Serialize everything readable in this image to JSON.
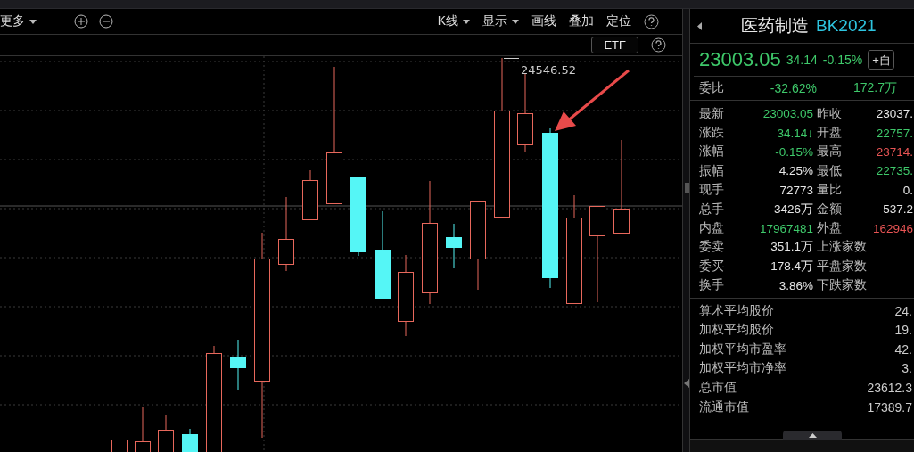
{
  "toolbar": {
    "left": [
      {
        "label": "更多",
        "dropdown": true
      }
    ],
    "right": [
      {
        "label": "K线",
        "dropdown": true
      },
      {
        "label": "显示",
        "dropdown": true
      },
      {
        "label": "画线",
        "dropdown": false
      },
      {
        "label": "叠加",
        "dropdown": false
      },
      {
        "label": "定位",
        "dropdown": false
      }
    ]
  },
  "subbar": {
    "button": "ETF"
  },
  "chart": {
    "high_label": "24546.52"
  },
  "quote": {
    "name": "医药制造",
    "code": "BK2021",
    "price": "23003.05",
    "change": "34.14",
    "change_pct": "-0.15%",
    "watch_button": "+自",
    "ratio_label": "委比",
    "ratio": "-32.62%",
    "ratio_diff": "172.7万",
    "stats": [
      {
        "label": "最新",
        "value": "23003.05",
        "color": "#3ec86a"
      },
      {
        "label": "昨收",
        "value": "23037.",
        "color": "#e6e6e6"
      },
      {
        "label": "涨跌",
        "value": "34.14↓",
        "color": "#3ec86a"
      },
      {
        "label": "开盘",
        "value": "22757.",
        "color": "#3ec86a"
      },
      {
        "label": "涨幅",
        "value": "-0.15%",
        "color": "#3ec86a"
      },
      {
        "label": "最高",
        "value": "23714.",
        "color": "#e85454"
      },
      {
        "label": "振幅",
        "value": "4.25%",
        "color": "#e6e6e6"
      },
      {
        "label": "最低",
        "value": "22735.",
        "color": "#3ec86a"
      },
      {
        "label": "现手",
        "value": "72773",
        "color": "#e6e6e6"
      },
      {
        "label": "量比",
        "value": "0.",
        "color": "#e6e6e6"
      },
      {
        "label": "总手",
        "value": "3426万",
        "color": "#e6e6e6"
      },
      {
        "label": "金额",
        "value": "537.2",
        "color": "#e6e6e6"
      },
      {
        "label": "内盘",
        "value": "17967481",
        "color": "#3ec86a"
      },
      {
        "label": "外盘",
        "value": "162946",
        "color": "#e85454"
      },
      {
        "label": "委卖",
        "value": "351.1万",
        "color": "#e6e6e6"
      },
      {
        "label": "上涨家数"
      },
      {
        "label": "委买",
        "value": "178.4万",
        "color": "#e6e6e6"
      },
      {
        "label": "平盘家数"
      },
      {
        "label": "换手",
        "value": "3.86%",
        "color": "#e6e6e6"
      },
      {
        "label": "下跌家数"
      }
    ],
    "summary": [
      {
        "label": "算术平均股价",
        "value": "24."
      },
      {
        "label": "加权平均股价",
        "value": "19."
      },
      {
        "label": "加权平均市盈率",
        "value": "42."
      },
      {
        "label": "加权平均市净率",
        "value": "3."
      },
      {
        "label": "总市值",
        "value": "23612.3"
      },
      {
        "label": "流通市值",
        "value": "17389.7"
      }
    ]
  }
}
